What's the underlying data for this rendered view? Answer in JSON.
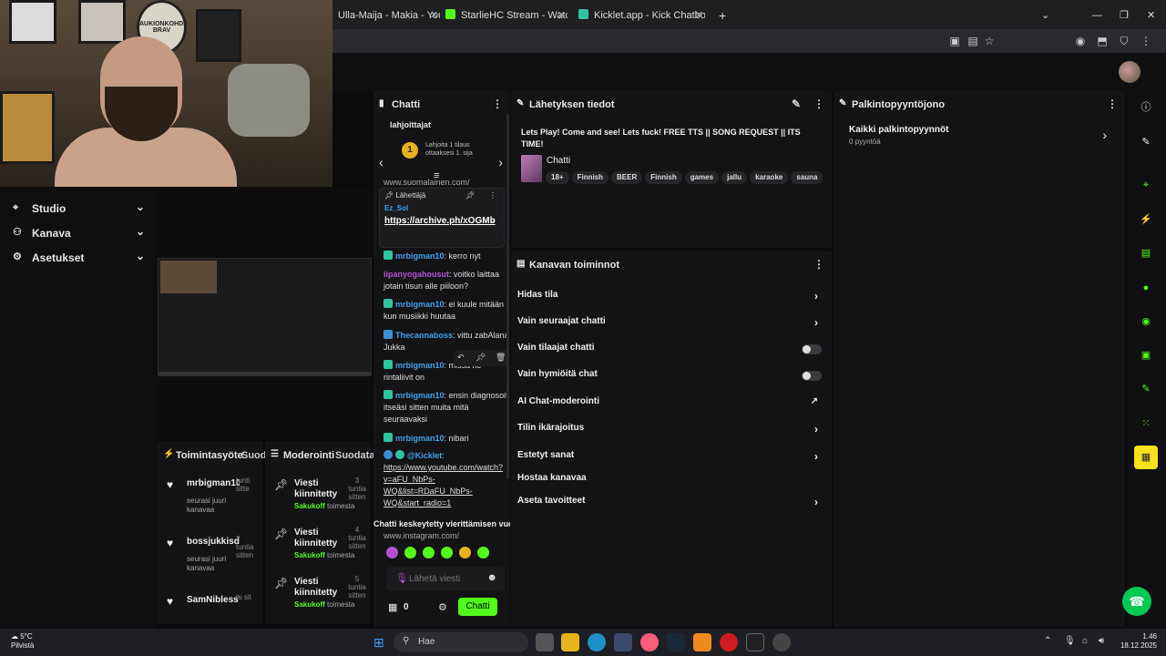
{
  "webcam": {
    "patch_text": "AUKIONKOHDE BRAV"
  },
  "browser": {
    "tabs": [
      {
        "label": "Ulla-Maija - Makia - YouTube",
        "color": "#ff0000"
      },
      {
        "label": "StarlieHC Stream - Watch Live on Kick",
        "color": "#53fc18"
      },
      {
        "label": "Kicklet.app - Kick Chatbot and Overlays",
        "color": "#2ec4a0"
      }
    ],
    "new_tab": "+",
    "win_controls": {
      "dropdown": "⌄",
      "minimize": "—",
      "restore": "❐",
      "close": "✕"
    }
  },
  "leftnav": {
    "items": [
      {
        "label": "Studio",
        "icon": "⌖"
      },
      {
        "label": "Kanava",
        "icon": "⚇"
      },
      {
        "label": "Asetukset",
        "icon": "⚙"
      }
    ]
  },
  "panels": {
    "activity_title": "Toimintasyöte",
    "activity_filter": "Suod",
    "moderation_title": "Moderointi",
    "moderation_filter": "Suodata"
  },
  "activity": [
    {
      "name": "mrbigman10",
      "time": "tunti sitte",
      "desc": "seurasi juuri kanavaa"
    },
    {
      "name": "bossjukkisd",
      "time": "2 tuntia sitten",
      "desc": "seurasi juuri kanavaa"
    },
    {
      "name": "SamNibless74",
      "time": "tu sit",
      "desc": ""
    }
  ],
  "moderation": [
    {
      "title": "Viesti kiinnitetty",
      "time": "3 tuntia sitten",
      "by": "Sakukoff",
      "action": "toimesta"
    },
    {
      "title": "Viesti kiinnitetty",
      "time": "4 tuntia sitten",
      "by": "Sakukoff",
      "action": "toimesta"
    },
    {
      "title": "Viesti kiinnitetty",
      "time": "5 tuntia sitten",
      "by": "Sakukoff",
      "action": "toimesta"
    }
  ],
  "chat": {
    "title": "Chatti",
    "banner_label": "lahjoittajat",
    "banner_rank": "1",
    "banner_text": "Lahjoita 1 tilaus ottaaksesi 1. sija",
    "partial_link": "www.suomalainen.com/",
    "pinned_header": "Lähettäjä",
    "pinned_user": "Ez_Sol",
    "pinned_link": "https://archive.ph/xOGMb",
    "messages": [
      {
        "user": "mrbigman10",
        "color": "#40a0e8",
        "text": ": kerro nyt"
      },
      {
        "user": "iipanyogahousut",
        "color": "#b64fd6",
        "text": ": voitko laittaa jotain tisun alle piiloon?"
      },
      {
        "user": "mrbigman10",
        "color": "#40a0e8",
        "text": ": ei kuule mitään kun musiikki huutaa"
      },
      {
        "user": "Thecannaboss",
        "color": "#40a0e8",
        "text": ": vittu zabAlana Jukka"
      },
      {
        "user": "mrbigman10",
        "color": "#40a0e8",
        "text": ": missä ne rintaliivit on"
      },
      {
        "user": "mrbigman10",
        "color": "#40a0e8",
        "text": ": ensin diagnosoit itseäsi sitten muita mitä seuraavaksi"
      },
      {
        "user": "mrbigman10",
        "color": "#40a0e8",
        "text": ": nibari"
      },
      {
        "user": "@Kicklet",
        "color": "#40a0e8",
        "text": "https://www.youtube.com/watch?v=aFU_NbPs-WQ&list=RDaFU_NbPs-WQ&start_radio=1"
      }
    ],
    "hold_text": "Chatti keskeytetty vierittämisen vuoksi",
    "partial_bottom": "www.instagram.com/",
    "emote_colors": [
      "#b64fd6",
      "#53fc18",
      "#53fc18",
      "#53fc18",
      "#e8b31a",
      "#53fc18"
    ],
    "input_placeholder": "Lähetä viesti",
    "store_count": "0",
    "send_label": "Chatti"
  },
  "stream_info": {
    "header": "Lähetyksen tiedot",
    "title": "Lets Play! Come and see! Lets fuck! FREE TTS || SONG REQUEST || ITS TIME!",
    "category": "Chatti",
    "tags": [
      "18+",
      "Finnish",
      "BEER",
      "Finnish",
      "games",
      "jallu",
      "karaoke",
      "sauna"
    ]
  },
  "channel_actions": {
    "header": "Kanavan toiminnot",
    "items": [
      {
        "label": "Hidas tila",
        "control": "chevron"
      },
      {
        "label": "Vain seuraajat chatti",
        "control": "chevron"
      },
      {
        "label": "Vain tilaajat chatti",
        "control": "toggle"
      },
      {
        "label": "Vain hymiöitä chat",
        "control": "toggle"
      },
      {
        "label": "AI Chat-moderointi",
        "control": "external"
      },
      {
        "label": "Tilin ikärajoitus",
        "control": "chevron"
      },
      {
        "label": "Estetyt sanat",
        "control": "chevron"
      },
      {
        "label": "Hostaa kanavaa",
        "control": "none"
      },
      {
        "label": "Aseta tavoitteet",
        "control": "chevron"
      }
    ]
  },
  "rewards": {
    "header": "Palkintopyyntöjono",
    "all_label": "Kaikki palkintopyynnöt",
    "count": "0 pyyntöä"
  },
  "taskbar": {
    "temp": "5°C",
    "weather": "Pilvistä",
    "search": "Hae",
    "time": "1.46",
    "date": "18.12.2025"
  }
}
